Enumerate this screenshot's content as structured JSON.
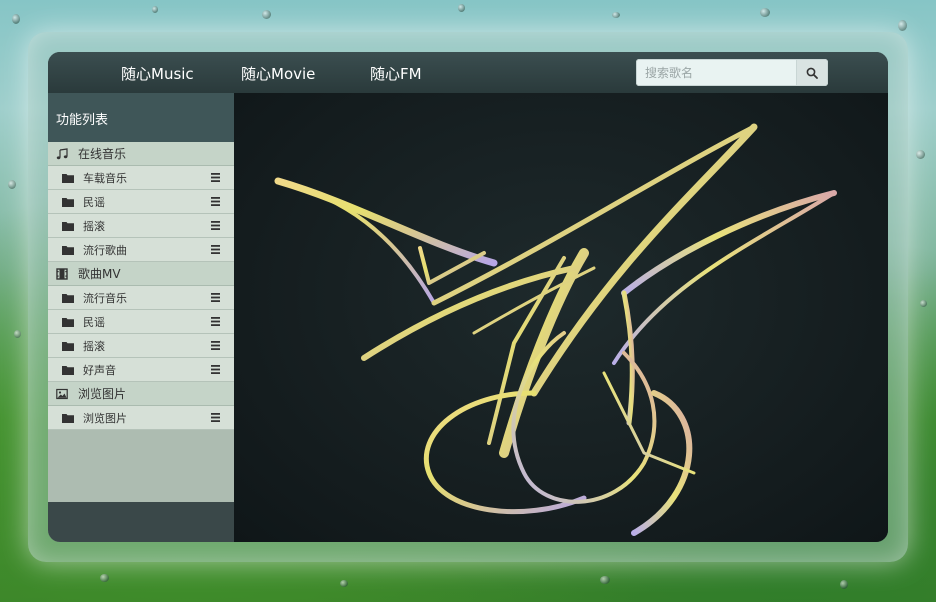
{
  "topnav": {
    "links": [
      {
        "label": "随心Music"
      },
      {
        "label": "随心Movie"
      },
      {
        "label": "随心FM"
      }
    ],
    "search": {
      "placeholder": "搜索歌名",
      "icon": "search-icon"
    }
  },
  "sidebar": {
    "title": "功能列表",
    "categories": [
      {
        "label": "在线音乐",
        "icon": "music-note-icon",
        "items": [
          {
            "label": "车载音乐"
          },
          {
            "label": "民谣"
          },
          {
            "label": "摇滚"
          },
          {
            "label": "流行歌曲"
          }
        ]
      },
      {
        "label": "歌曲MV",
        "icon": "film-icon",
        "items": [
          {
            "label": "流行音乐"
          },
          {
            "label": "民谣"
          },
          {
            "label": "摇滚"
          },
          {
            "label": "好声音"
          }
        ]
      },
      {
        "label": "浏览图片",
        "icon": "picture-icon",
        "items": [
          {
            "label": "浏览图片"
          }
        ]
      }
    ],
    "item_icons": {
      "folder": "folder-icon",
      "menu": "menu-icon"
    }
  },
  "main": {
    "logo": "logo-graphic"
  },
  "colors": {
    "nav_bg": "#2a3a3b",
    "sidebar_header_bg": "#3f5658",
    "main_bg": "#141c1e",
    "logo_yellow": "#e8e27a",
    "logo_purple": "#b7a6e6"
  }
}
